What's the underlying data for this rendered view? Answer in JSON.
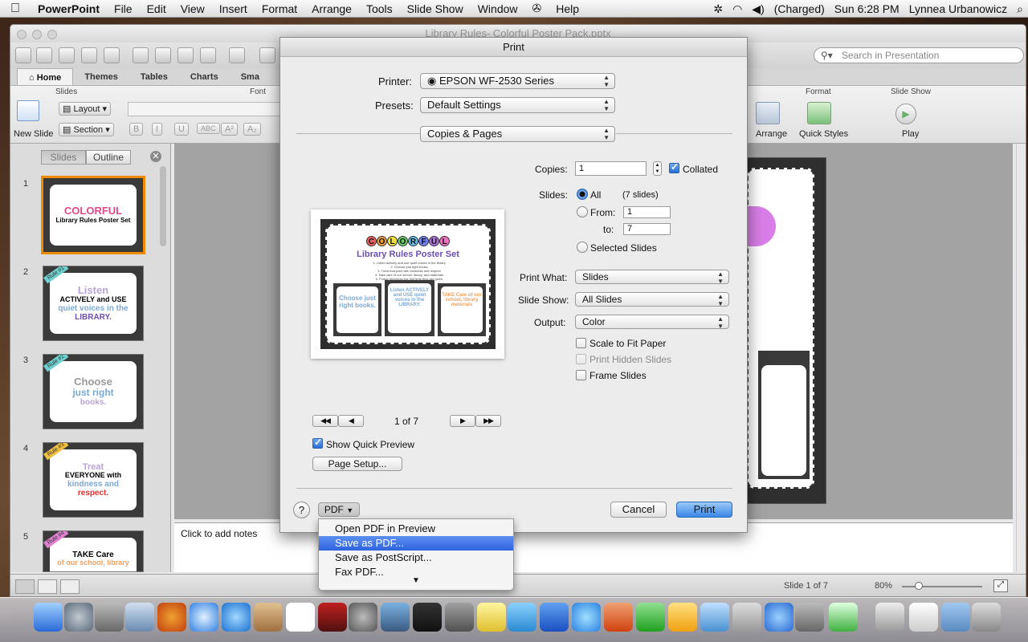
{
  "menubar": {
    "apple": "",
    "app_name": "PowerPoint",
    "items": [
      "File",
      "Edit",
      "View",
      "Insert",
      "Format",
      "Arrange",
      "Tools",
      "Slide Show",
      "Window",
      "✇",
      "Help"
    ],
    "status": {
      "bluetooth": "✲",
      "wifi": "◠",
      "volume": "◀)",
      "battery": "(Charged)",
      "clock": "Sun 6:28 PM",
      "user": "Lynnea Urbanowicz",
      "spotlight": "⌕"
    }
  },
  "window": {
    "title": "Library Rules- Colorful Poster Pack.pptx",
    "search_placeholder": "Search in Presentation"
  },
  "ribbon": {
    "tabs": [
      "Home",
      "Themes",
      "Tables",
      "Charts",
      "Sma"
    ],
    "groups": {
      "slides": "Slides",
      "font": "Font",
      "format": "Format",
      "slideshow": "Slide Show"
    },
    "new_slide": "New Slide",
    "layout": "Layout",
    "section": "Section",
    "font_buttons": [
      "B",
      "I",
      "U",
      "ABC",
      "A²",
      "A₂"
    ],
    "arrange": "Arrange",
    "quick_styles": "Quick Styles",
    "play": "Play"
  },
  "left_panel": {
    "tabs": [
      "Slides",
      "Outline"
    ],
    "close": "✕",
    "slides": [
      {
        "num": "1",
        "lines": [
          "COLORFUL",
          "Library Rules Poster Set",
          "",
          ""
        ],
        "rule": ""
      },
      {
        "num": "2",
        "lines": [
          "Listen",
          "ACTIVELY and USE",
          "quiet voices in the",
          "LIBRARY."
        ],
        "rule": "Rule #1"
      },
      {
        "num": "3",
        "lines": [
          "Choose",
          "just right",
          "books.",
          ""
        ],
        "rule": "Rule #2"
      },
      {
        "num": "4",
        "lines": [
          "Treat",
          "EVERYONE with",
          "kindness and",
          "respect."
        ],
        "rule": "Rule #3"
      },
      {
        "num": "5",
        "lines": [
          "TAKE Care",
          "of our school, library",
          "",
          ""
        ],
        "rule": "Rule #4"
      }
    ]
  },
  "notes": {
    "placeholder": "Click to add notes"
  },
  "statusbar": {
    "slide_indicator": "Slide 1 of 7",
    "zoom": "80%"
  },
  "print_dialog": {
    "title": "Print",
    "printer_label": "Printer:",
    "printer_value": "EPSON WF-2530 Series",
    "presets_label": "Presets:",
    "presets_value": "Default Settings",
    "section_value": "Copies & Pages",
    "copies_label": "Copies:",
    "copies_value": "1",
    "collated_label": "Collated",
    "collated_checked": true,
    "slides_label": "Slides:",
    "all_label": "All",
    "slide_count": "(7 slides)",
    "from_label": "From:",
    "from_value": "1",
    "to_label": "to:",
    "to_value": "7",
    "selected_slides_label": "Selected Slides",
    "print_what_label": "Print What:",
    "print_what_value": "Slides",
    "slide_show_label": "Slide Show:",
    "slide_show_value": "All Slides",
    "output_label": "Output:",
    "output_value": "Color",
    "scale_label": "Scale to Fit Paper",
    "hidden_label": "Print Hidden Slides",
    "frame_label": "Frame Slides",
    "page_indicator": "1 of 7",
    "show_preview_label": "Show Quick Preview",
    "page_setup_label": "Page Setup...",
    "help": "?",
    "pdf_label": "PDF",
    "cancel_label": "Cancel",
    "print_label": "Print",
    "preview": {
      "title_letters": [
        "C",
        "O",
        "L",
        "O",
        "R",
        "F",
        "U",
        "L"
      ],
      "subtitle": "Library Rules Poster Set",
      "rules": [
        "1. Listen actively and use quiet voices in the library.",
        "2. Choose just right books.",
        "3. Treat everyone with kindness and respect.",
        "4. Take care of our school, library, and materials.",
        "5. Follow directions the first time they are given."
      ],
      "mini_texts": [
        "Choose just right books.",
        "Listen ACTIVELY and USE quiet voices in the LIBRARY.",
        "TAKE Care of our school, library materials"
      ]
    }
  },
  "pdf_menu": {
    "items": [
      "Open PDF in Preview",
      "Save as PDF...",
      "Save as PostScript...",
      "Fax PDF..."
    ],
    "highlighted": 1,
    "more": "▼"
  },
  "colors": {
    "accent": "#3a88e6",
    "highlight": "#2e63df",
    "selected_thumb": "#f08a00"
  }
}
